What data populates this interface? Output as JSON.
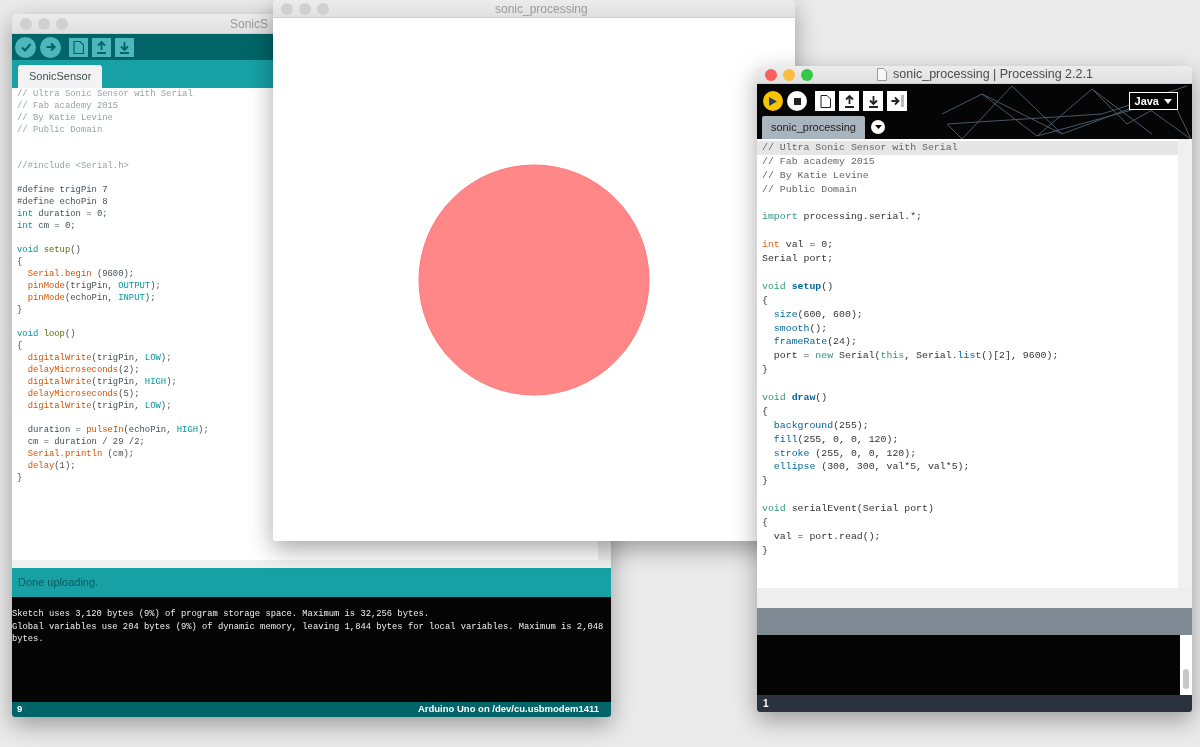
{
  "windows": [
    {
      "kind": "processing",
      "title": "sonic_processing | Processing 2.2.1",
      "active": true,
      "mode": "Java",
      "tab": "sonic_processing",
      "blocks": [
        {
          "lines": [
            {
              "current": true,
              "tokens": [
                {
                  "text": "// Ultra Sonic Sensor with Serial",
                  "kind": "comment"
                }
              ]
            },
            {
              "current": false,
              "tokens": [
                {
                  "text": "// Fab academy 2015",
                  "kind": "comment"
                }
              ]
            },
            {
              "current": false,
              "tokens": [
                {
                  "text": "// By Katie Levine",
                  "kind": "comment"
                }
              ]
            },
            {
              "current": false,
              "tokens": [
                {
                  "text": "// Public Domain",
                  "kind": "comment"
                }
              ]
            }
          ]
        },
        {
          "wide_gap": false,
          "lines": [
            {
              "current": false,
              "tokens": [
                {
                  "text": "import",
                  "kind": "keyword"
                },
                {
                  "text": " processing.serial.*;",
                  "kind": "plain"
                }
              ]
            }
          ]
        },
        {
          "wide_gap": false,
          "lines": [
            {
              "current": false,
              "tokens": [
                {
                  "text": "int",
                  "kind": "type"
                },
                {
                  "text": " val = 0;",
                  "kind": "plain"
                }
              ]
            },
            {
              "current": false,
              "tokens": [
                {
                  "text": "Serial port;",
                  "kind": "plain"
                }
              ]
            }
          ]
        },
        {
          "wide_gap": false,
          "lines": [
            {
              "current": false,
              "tokens": [
                {
                  "text": "void ",
                  "kind": "keyword"
                },
                {
                  "text": "setup",
                  "kind": "definition"
                },
                {
                  "text": "()",
                  "kind": "plain"
                }
              ]
            },
            {
              "current": false,
              "tokens": [
                {
                  "text": "{",
                  "kind": "plain"
                }
              ]
            },
            {
              "current": false,
              "tokens": [
                {
                  "text": "  size",
                  "kind": "function"
                },
                {
                  "text": "(600, 600);",
                  "kind": "plain"
                }
              ]
            },
            {
              "current": false,
              "tokens": [
                {
                  "text": "  smooth",
                  "kind": "function"
                },
                {
                  "text": "();",
                  "kind": "plain"
                }
              ]
            },
            {
              "current": false,
              "tokens": [
                {
                  "text": "  frameRate",
                  "kind": "function"
                },
                {
                  "text": "(24);",
                  "kind": "plain"
                }
              ]
            },
            {
              "current": false,
              "tokens": [
                {
                  "text": "  port = ",
                  "kind": "plain"
                },
                {
                  "text": "new",
                  "kind": "keyword"
                },
                {
                  "text": " Serial(",
                  "kind": "plain"
                },
                {
                  "text": "this",
                  "kind": "keyword"
                },
                {
                  "text": ", Serial.",
                  "kind": "plain"
                },
                {
                  "text": "list",
                  "kind": "function"
                },
                {
                  "text": "()[2], 9600);",
                  "kind": "plain"
                }
              ]
            },
            {
              "current": false,
              "tokens": [
                {
                  "text": "}",
                  "kind": "plain"
                }
              ]
            }
          ]
        },
        {
          "wide_gap": false,
          "lines": [
            {
              "current": false,
              "tokens": [
                {
                  "text": "void ",
                  "kind": "keyword"
                },
                {
                  "text": "draw",
                  "kind": "definition"
                },
                {
                  "text": "()",
                  "kind": "plain"
                }
              ]
            },
            {
              "current": false,
              "tokens": [
                {
                  "text": "{",
                  "kind": "plain"
                }
              ]
            },
            {
              "current": false,
              "tokens": [
                {
                  "text": "  background",
                  "kind": "function"
                },
                {
                  "text": "(255);",
                  "kind": "plain"
                }
              ]
            },
            {
              "current": false,
              "tokens": [
                {
                  "text": "  fill",
                  "kind": "function"
                },
                {
                  "text": "(255, 0, 0, 120);",
                  "kind": "plain"
                }
              ]
            },
            {
              "current": false,
              "tokens": [
                {
                  "text": "  stroke",
                  "kind": "function"
                },
                {
                  "text": " (255, 0, 0, 120);",
                  "kind": "plain"
                }
              ]
            },
            {
              "current": false,
              "tokens": [
                {
                  "text": "  ellipse",
                  "kind": "function"
                },
                {
                  "text": " (300, 300, val*5, val*5);",
                  "kind": "plain"
                }
              ]
            },
            {
              "current": false,
              "tokens": [
                {
                  "text": "}",
                  "kind": "plain"
                }
              ]
            }
          ]
        },
        {
          "wide_gap": false,
          "lines": [
            {
              "current": false,
              "tokens": [
                {
                  "text": "void",
                  "kind": "keyword"
                },
                {
                  "text": " serialEvent(Serial port)",
                  "kind": "plain"
                }
              ]
            },
            {
              "current": false,
              "tokens": [
                {
                  "text": "{",
                  "kind": "plain"
                }
              ]
            },
            {
              "current": false,
              "tokens": [
                {
                  "text": "  val = port.read();",
                  "kind": "plain"
                }
              ]
            },
            {
              "current": false,
              "tokens": [
                {
                  "text": "}",
                  "kind": "plain"
                }
              ]
            }
          ]
        }
      ],
      "line_number": "1"
    },
    {
      "kind": "sketch",
      "title": "sonic_processing",
      "active": false
    },
    {
      "kind": "arduino",
      "title": "SonicS",
      "active": false,
      "tab": "SonicSensor",
      "blocks": [
        {
          "lines": [
            {
              "tokens": [
                {
                  "text": "// Ultra Sonic Sensor with Serial",
                  "kind": "comment"
                }
              ]
            },
            {
              "tokens": [
                {
                  "text": "// Fab academy 2015",
                  "kind": "comment"
                }
              ]
            },
            {
              "tokens": [
                {
                  "text": "// By Katie Levine",
                  "kind": "comment"
                }
              ]
            },
            {
              "tokens": [
                {
                  "text": "// Public Domain",
                  "kind": "comment"
                }
              ]
            }
          ]
        },
        {
          "wide_gap": true,
          "lines": [
            {
              "tokens": [
                {
                  "text": "//#include <Serial.h>",
                  "kind": "comment"
                }
              ]
            }
          ]
        },
        {
          "wide_gap": false,
          "lines": [
            {
              "tokens": [
                {
                  "text": "#define trigPin 7",
                  "kind": "plain"
                }
              ]
            },
            {
              "tokens": [
                {
                  "text": "#define echoPin 8",
                  "kind": "plain"
                }
              ]
            },
            {
              "tokens": [
                {
                  "text": "int",
                  "kind": "keyword"
                },
                {
                  "text": " duration = 0;",
                  "kind": "plain"
                }
              ]
            },
            {
              "tokens": [
                {
                  "text": "int",
                  "kind": "keyword"
                },
                {
                  "text": " cm = 0;",
                  "kind": "plain"
                }
              ]
            }
          ]
        },
        {
          "wide_gap": false,
          "lines": [
            {
              "tokens": [
                {
                  "text": "void ",
                  "kind": "keyword"
                },
                {
                  "text": "setup",
                  "kind": "definition"
                },
                {
                  "text": "()",
                  "kind": "plain"
                }
              ]
            },
            {
              "tokens": [
                {
                  "text": "{",
                  "kind": "plain"
                }
              ]
            },
            {
              "tokens": [
                {
                  "text": "  Serial.begin",
                  "kind": "function"
                },
                {
                  "text": " (9600);",
                  "kind": "plain"
                }
              ]
            },
            {
              "tokens": [
                {
                  "text": "  pinMode",
                  "kind": "function"
                },
                {
                  "text": "(trigPin, ",
                  "kind": "plain"
                },
                {
                  "text": "OUTPUT",
                  "kind": "constant"
                },
                {
                  "text": ");",
                  "kind": "plain"
                }
              ]
            },
            {
              "tokens": [
                {
                  "text": "  pinMode",
                  "kind": "function"
                },
                {
                  "text": "(echoPin, ",
                  "kind": "plain"
                },
                {
                  "text": "INPUT",
                  "kind": "constant"
                },
                {
                  "text": ");",
                  "kind": "plain"
                }
              ]
            },
            {
              "tokens": [
                {
                  "text": "}",
                  "kind": "plain"
                }
              ]
            }
          ]
        },
        {
          "wide_gap": false,
          "lines": [
            {
              "tokens": [
                {
                  "text": "void ",
                  "kind": "keyword"
                },
                {
                  "text": "loop",
                  "kind": "definition"
                },
                {
                  "text": "()",
                  "kind": "plain"
                }
              ]
            },
            {
              "tokens": [
                {
                  "text": "{",
                  "kind": "plain"
                }
              ]
            },
            {
              "tokens": [
                {
                  "text": "  digitalWrite",
                  "kind": "function"
                },
                {
                  "text": "(trigPin, ",
                  "kind": "plain"
                },
                {
                  "text": "LOW",
                  "kind": "constant"
                },
                {
                  "text": ");",
                  "kind": "plain"
                }
              ]
            },
            {
              "tokens": [
                {
                  "text": "  delayMicroseconds",
                  "kind": "function"
                },
                {
                  "text": "(2);",
                  "kind": "plain"
                }
              ]
            },
            {
              "tokens": [
                {
                  "text": "  digitalWrite",
                  "kind": "function"
                },
                {
                  "text": "(trigPin, ",
                  "kind": "plain"
                },
                {
                  "text": "HIGH",
                  "kind": "constant"
                },
                {
                  "text": ");",
                  "kind": "plain"
                }
              ]
            },
            {
              "tokens": [
                {
                  "text": "  delayMicroseconds",
                  "kind": "function"
                },
                {
                  "text": "(5);",
                  "kind": "plain"
                }
              ]
            },
            {
              "tokens": [
                {
                  "text": "  digitalWrite",
                  "kind": "function"
                },
                {
                  "text": "(trigPin, ",
                  "kind": "plain"
                },
                {
                  "text": "LOW",
                  "kind": "constant"
                },
                {
                  "text": ");",
                  "kind": "plain"
                }
              ]
            }
          ]
        },
        {
          "wide_gap": false,
          "lines": [
            {
              "tokens": [
                {
                  "text": "  duration = ",
                  "kind": "plain"
                },
                {
                  "text": "pulseIn",
                  "kind": "function"
                },
                {
                  "text": "(echoPin, ",
                  "kind": "plain"
                },
                {
                  "text": "HIGH",
                  "kind": "constant"
                },
                {
                  "text": ");",
                  "kind": "plain"
                }
              ]
            },
            {
              "tokens": [
                {
                  "text": "  cm = duration / 29 /2;",
                  "kind": "plain"
                }
              ]
            },
            {
              "tokens": [
                {
                  "text": "  Serial.println",
                  "kind": "function"
                },
                {
                  "text": " (cm);",
                  "kind": "plain"
                }
              ]
            },
            {
              "tokens": [
                {
                  "text": "  delay",
                  "kind": "function"
                },
                {
                  "text": "(1);",
                  "kind": "plain"
                }
              ]
            },
            {
              "tokens": [
                {
                  "text": "}",
                  "kind": "plain"
                }
              ]
            }
          ]
        }
      ],
      "status": "Done uploading.",
      "console": [
        "Sketch uses 3,120 bytes (9%) of program storage space. Maximum is 32,256 bytes.",
        "Global variables use 204 bytes (9%) of dynamic memory, leaving 1,844 bytes for local variables. Maximum is 2,048",
        "bytes."
      ],
      "line_number": "9",
      "board": "Arduino Uno on /dev/cu.usbmodem1411"
    }
  ]
}
